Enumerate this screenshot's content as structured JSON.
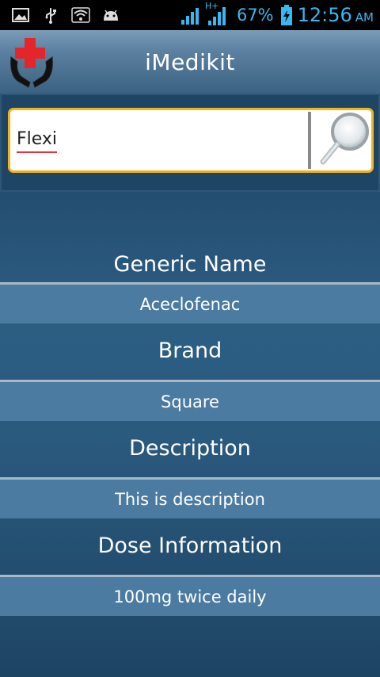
{
  "status_bar": {
    "battery": "67%",
    "time": "12:56",
    "ampm": "AM",
    "network_label": "H+",
    "icons": [
      "gallery-icon",
      "usb-icon",
      "wifi-icon",
      "android-icon",
      "signal-icon",
      "signal-icon",
      "battery-charging-icon"
    ]
  },
  "header": {
    "title": "iMedikit",
    "logo_icon": "medical-hands-cross-icon"
  },
  "search": {
    "query": "Flexi",
    "button_icon": "magnifier-icon"
  },
  "details": {
    "generic_label": "Generic Name",
    "generic_value": "Aceclofenac",
    "brand_label": "Brand",
    "brand_value": "Square",
    "description_label": "Description",
    "description_value": "This is description",
    "dose_label": "Dose Information",
    "dose_value": "100mg twice daily"
  },
  "colors": {
    "accent": "#f4b21b",
    "statusbar_text": "#39b7f0",
    "logo_red": "#e4262b"
  }
}
